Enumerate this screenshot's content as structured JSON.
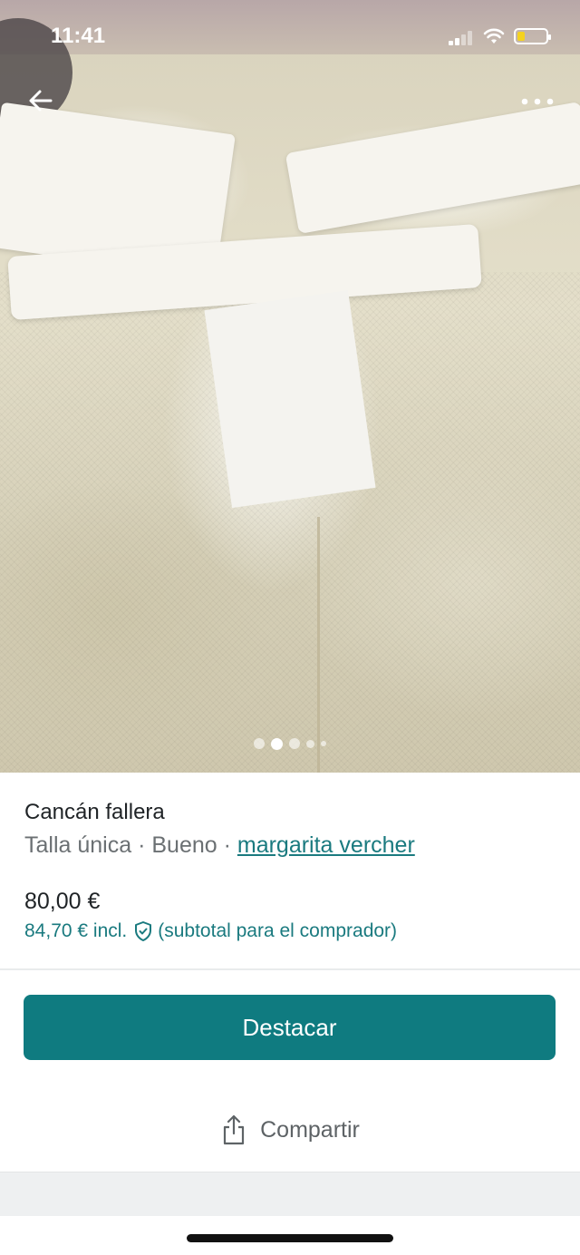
{
  "status_bar": {
    "time": "11:41",
    "battery_level": 0.25
  },
  "header": {
    "back_icon": "arrow-left-icon",
    "more_icon": "more-horizontal-icon"
  },
  "gallery": {
    "image_count": 5,
    "active_index": 1
  },
  "listing": {
    "title": "Cancán fallera",
    "size": "Talla única",
    "separator": " · ",
    "condition": "Bueno",
    "seller": "margarita vercher",
    "price": "80,00 €",
    "price_incl": "84,70 € incl.",
    "price_incl_note": "(subtotal para el comprador)"
  },
  "actions": {
    "primary_label": "Destacar",
    "share_label": "Compartir"
  },
  "colors": {
    "accent": "#0f7b80",
    "link": "#1a7a7f",
    "battery": "#f4d21f"
  }
}
